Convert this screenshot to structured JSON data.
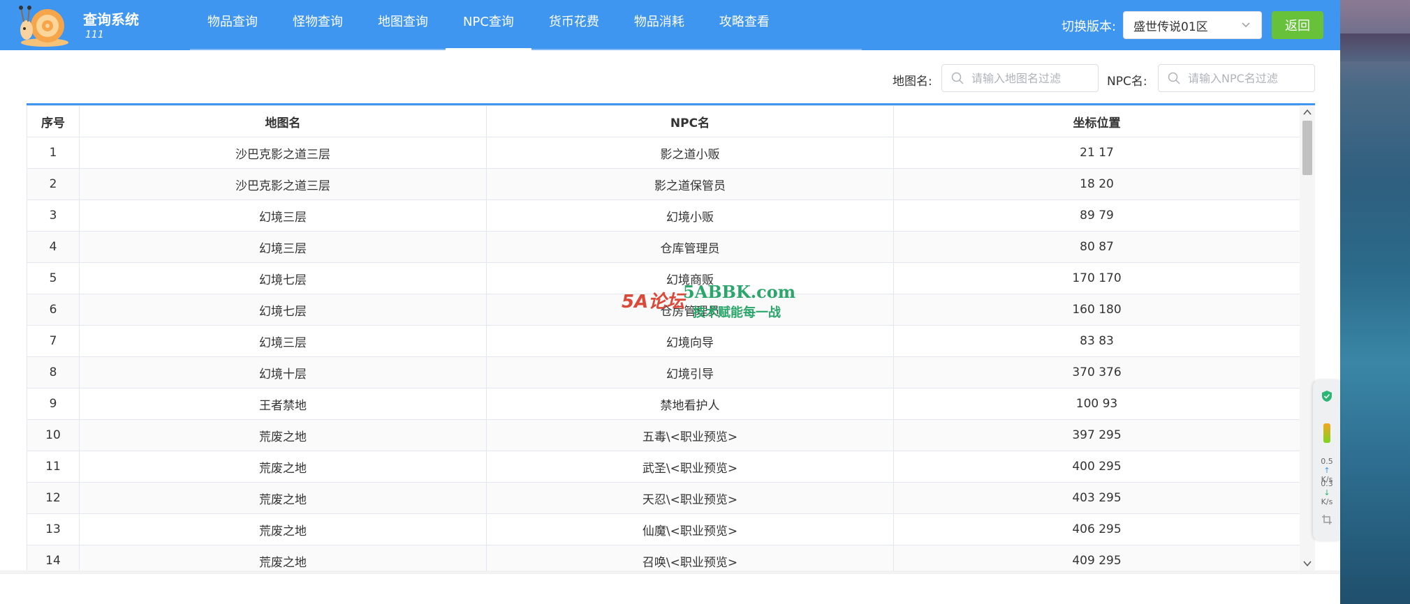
{
  "app": {
    "title": "查询系统",
    "subtitle": "111"
  },
  "nav": {
    "items": [
      {
        "label": "物品查询",
        "active": false
      },
      {
        "label": "怪物查询",
        "active": false
      },
      {
        "label": "地图查询",
        "active": false
      },
      {
        "label": "NPC查询",
        "active": true
      },
      {
        "label": "货币花费",
        "active": false
      },
      {
        "label": "物品消耗",
        "active": false
      },
      {
        "label": "攻略查看",
        "active": false
      }
    ]
  },
  "version": {
    "label": "切换版本:",
    "selected": "盛世传说01区"
  },
  "back_label": "返回",
  "filters": {
    "map_label": "地图名:",
    "map_placeholder": "请输入地图名过滤",
    "npc_label": "NPC名:",
    "npc_placeholder": "请输入NPC名过滤"
  },
  "table": {
    "headers": [
      "序号",
      "地图名",
      "NPC名",
      "坐标位置"
    ],
    "rows": [
      [
        "1",
        "沙巴克影之道三层",
        "影之道小贩",
        "21 17"
      ],
      [
        "2",
        "沙巴克影之道三层",
        "影之道保管员",
        "18 20"
      ],
      [
        "3",
        "幻境三层",
        "幻境小贩",
        "89 79"
      ],
      [
        "4",
        "幻境三层",
        "仓库管理员",
        "80 87"
      ],
      [
        "5",
        "幻境七层",
        "幻境商贩",
        "170 170"
      ],
      [
        "6",
        "幻境七层",
        "仓房管理员",
        "160 180"
      ],
      [
        "7",
        "幻境三层",
        "幻境向导",
        "83 83"
      ],
      [
        "8",
        "幻境十层",
        "幻境引导",
        "370 376"
      ],
      [
        "9",
        "王者禁地",
        "禁地看护人",
        "100 93"
      ],
      [
        "10",
        "荒废之地",
        "五毒\\<职业预览>",
        "397 295"
      ],
      [
        "11",
        "荒废之地",
        "武圣\\<职业预览>",
        "400 295"
      ],
      [
        "12",
        "荒废之地",
        "天忍\\<职业预览>",
        "403 295"
      ],
      [
        "13",
        "荒废之地",
        "仙魔\\<职业预览>",
        "406 295"
      ],
      [
        "14",
        "荒废之地",
        "召唤\\<职业预览>",
        "409 295"
      ]
    ]
  },
  "watermark": {
    "logo_text": "5A论坛",
    "site": "5ABBK.com",
    "slogan": "技术赋能每一战"
  },
  "widget": {
    "up_speed": "0.5",
    "up_unit": "K/s",
    "down_speed": "0.3",
    "down_unit": "K/s"
  },
  "colors": {
    "header": "#3f96f0",
    "back_button": "#67c23a",
    "table_accent": "#3f96f0"
  }
}
